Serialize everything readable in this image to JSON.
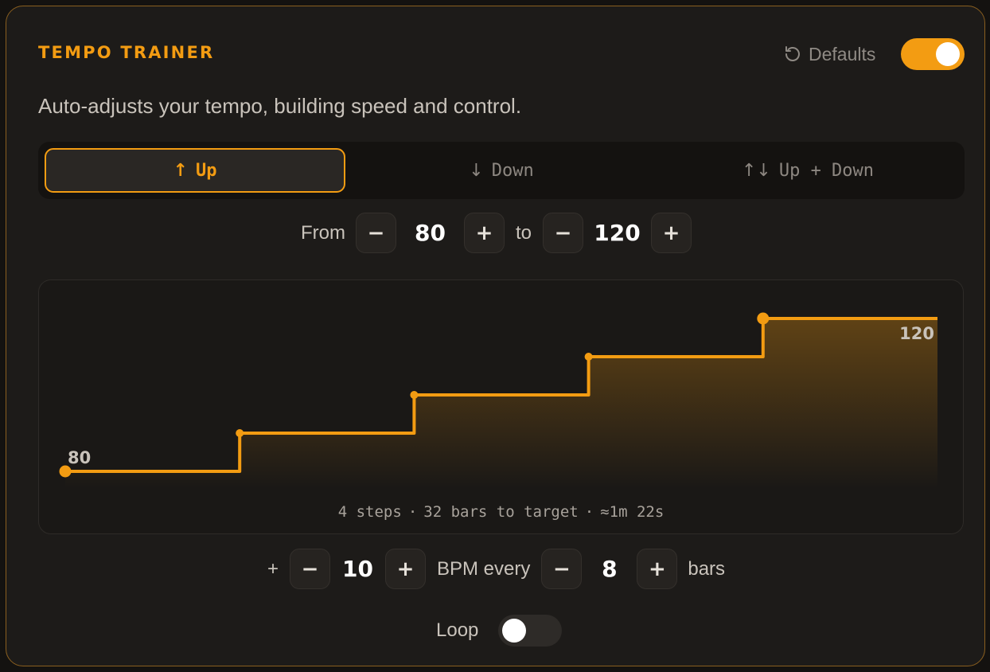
{
  "header": {
    "title": "TEMPO TRAINER",
    "defaults_label": "Defaults",
    "enabled": true
  },
  "subtitle": "Auto-adjusts your tempo, building speed and control.",
  "modes": [
    {
      "arrow": "↑",
      "label": "Up",
      "active": true
    },
    {
      "arrow": "↓",
      "label": "Down",
      "active": false
    },
    {
      "arrow": "↑↓",
      "label": "Up + Down",
      "active": false
    }
  ],
  "range": {
    "from_label": "From",
    "from": "80",
    "to_label": "to",
    "to": "120",
    "minus": "−",
    "plus": "+"
  },
  "chart_data": {
    "type": "line",
    "step": true,
    "x": [
      0,
      8,
      16,
      24,
      32,
      40
    ],
    "y": [
      80,
      90,
      100,
      110,
      120,
      120
    ],
    "ylim": [
      80,
      120
    ],
    "start_label": "80",
    "end_label": "120",
    "color": "#f39c12"
  },
  "summary": {
    "steps": "4 steps",
    "bars": "32 bars to target",
    "time": "≈1m 22s",
    "separator": "·"
  },
  "increment": {
    "prefix": "+",
    "bpm": "10",
    "bpm_label": "BPM every",
    "bars": "8",
    "bars_label": "bars"
  },
  "loop": {
    "label": "Loop",
    "enabled": false
  }
}
